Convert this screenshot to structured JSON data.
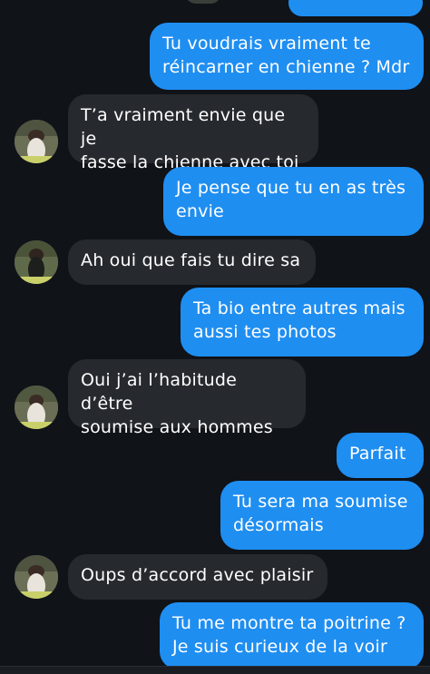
{
  "messages": [
    {
      "from": "me",
      "text": "Tu voudrais vraiment te\nréincarner en chienne ? Mdr"
    },
    {
      "from": "them",
      "text": "T’a vraiment envie que je\nfasse la chienne avec toi"
    },
    {
      "from": "me",
      "text": "Je pense que tu en as très\nenvie"
    },
    {
      "from": "them",
      "text": "Ah oui que fais tu dire sa"
    },
    {
      "from": "me",
      "text": "Ta bio entre autres mais\naussi tes photos"
    },
    {
      "from": "them",
      "text": "Oui j’ai l’habitude d’être\nsoumise aux hommes"
    },
    {
      "from": "me",
      "text": "Parfait"
    },
    {
      "from": "me",
      "text": "Tu sera ma soumise\ndésormais"
    },
    {
      "from": "them",
      "text": "Oups d’accord avec plaisir"
    },
    {
      "from": "me",
      "text": "Tu me montre ta poitrine ?\nJe suis curieux de la voir"
    }
  ],
  "colors": {
    "background": "#101318",
    "sent_bubble": "#1f8ef1",
    "received_bubble": "#26292e",
    "text": "#ffffff"
  },
  "icons": {
    "avatar": "contact-avatar-icon"
  }
}
